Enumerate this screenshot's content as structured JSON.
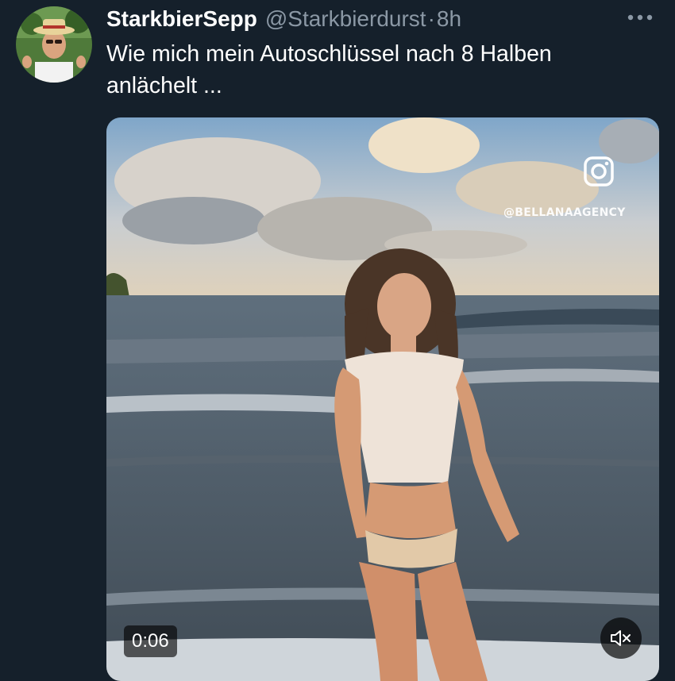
{
  "author": {
    "display_name": "StarkbierSepp",
    "handle": "@Starkbierdurst",
    "separator": "·",
    "time": "8h",
    "avatar_icon": "profile-photo"
  },
  "tweet": {
    "text": "Wie mich mein Autoschlüssel nach 8 Halben\nanlächelt ..."
  },
  "more_menu": {
    "icon": "more-horizontal-icon"
  },
  "media": {
    "watermark": "@BELLANAAGENCY",
    "watermark_icon": "instagram-icon",
    "duration": "0:06",
    "mute_icon": "speaker-muted-icon"
  },
  "colors": {
    "background": "#15202b",
    "text_primary": "#ffffff",
    "text_secondary": "#8b98a5"
  }
}
